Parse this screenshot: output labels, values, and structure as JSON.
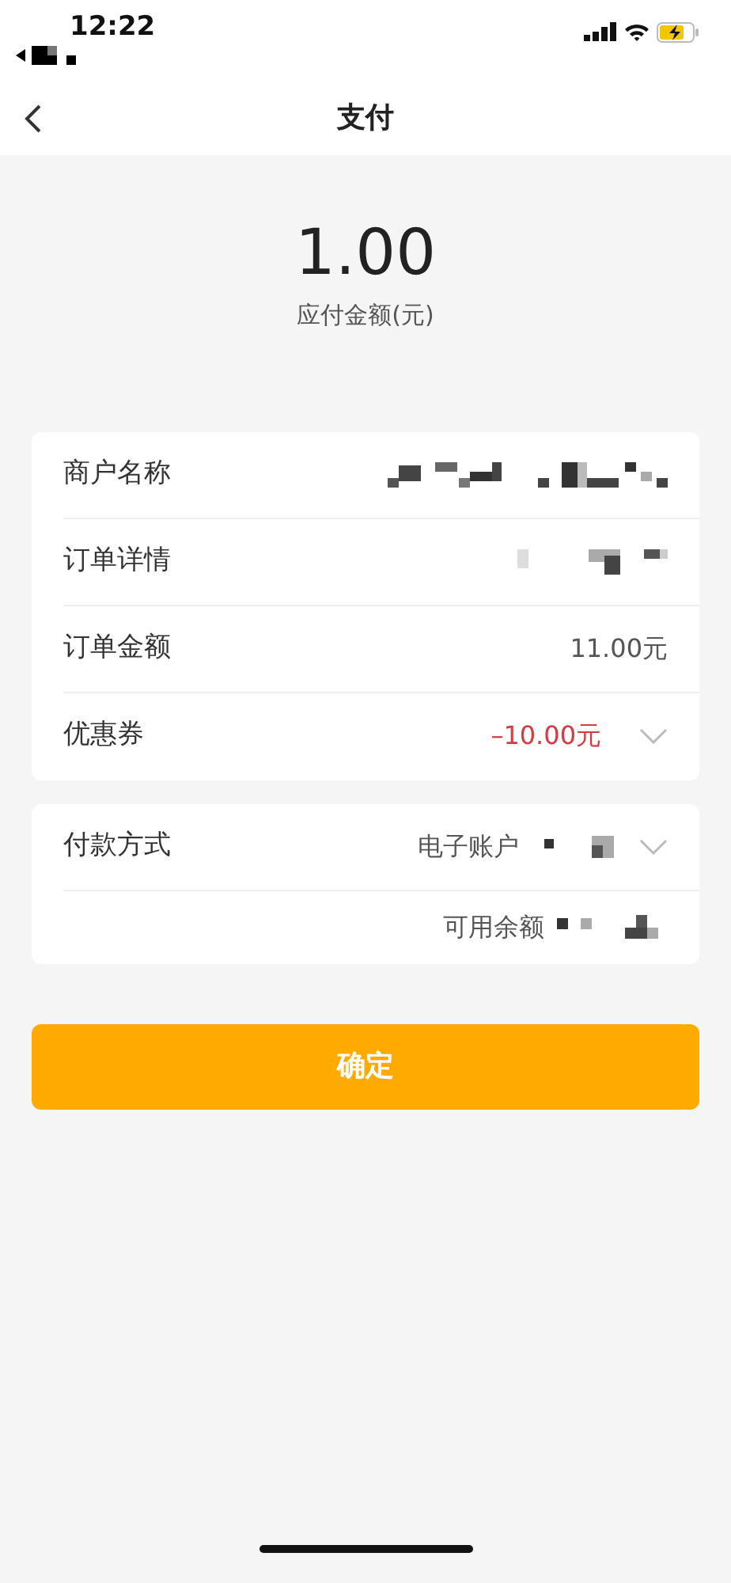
{
  "status_bar": {
    "time": "12:22",
    "back_app_redacted": true
  },
  "nav": {
    "title": "支付"
  },
  "amount": {
    "value": "1.00",
    "caption": "应付金额(元)"
  },
  "order_card": [
    {
      "label": "商户名称",
      "redacted": true,
      "dropdown": false
    },
    {
      "label": "订单详情",
      "redacted": true,
      "dropdown": false
    },
    {
      "label": "订单金额",
      "value": "11.00元",
      "redacted": false,
      "discount": false,
      "dropdown": false
    },
    {
      "label": "优惠券",
      "value": "–10.00元",
      "redacted": false,
      "discount": true,
      "dropdown": true
    }
  ],
  "payment_card": {
    "label": "付款方式",
    "value": "电子账户",
    "redacted": true,
    "dropdown": true,
    "balance_label": "可用余额",
    "balance_redacted": true
  },
  "confirm_button": "确定"
}
